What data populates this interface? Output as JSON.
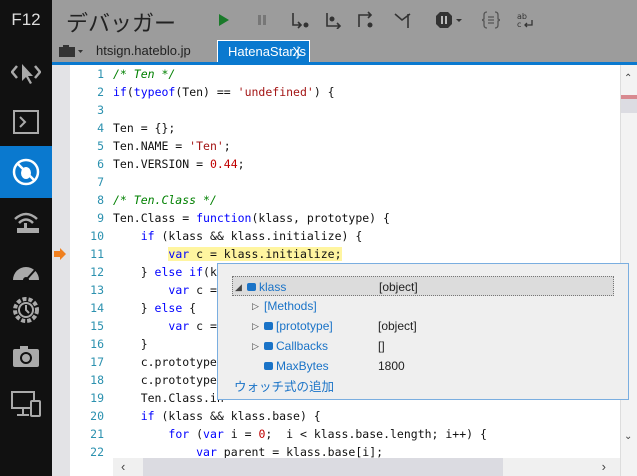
{
  "sidebar": {
    "f12_label": "F12",
    "items": [
      "dom-explorer",
      "console",
      "debugger",
      "network",
      "ui-responsiveness",
      "profiler",
      "memory",
      "emulation"
    ],
    "active": "debugger"
  },
  "toolbar": {
    "title": "デバッガー"
  },
  "tabs": [
    {
      "label": "htsign.hateblo.jp",
      "active": false
    },
    {
      "label": "HatenaStar.js",
      "active": true,
      "close": "X"
    }
  ],
  "code": {
    "current_line": 11,
    "lines": [
      [
        [
          "com",
          "/* Ten */"
        ]
      ],
      [
        [
          "kw",
          "if"
        ],
        [
          "",
          "("
        ],
        [
          "kw",
          "typeof"
        ],
        [
          "",
          "(Ten) == "
        ],
        [
          "str",
          "'undefined'"
        ],
        [
          "",
          ") {"
        ]
      ],
      [],
      [
        [
          "",
          "Ten = {};"
        ]
      ],
      [
        [
          "",
          "Ten.NAME = "
        ],
        [
          "str",
          "'Ten'"
        ],
        [
          "",
          ";"
        ]
      ],
      [
        [
          "",
          "Ten.VERSION = "
        ],
        [
          "num",
          "0.44"
        ],
        [
          "",
          ";"
        ]
      ],
      [],
      [
        [
          "com",
          "/* Ten.Class */"
        ]
      ],
      [
        [
          "",
          "Ten.Class = "
        ],
        [
          "kw",
          "function"
        ],
        [
          "",
          "(klass, prototype) {"
        ]
      ],
      [
        [
          "",
          "    "
        ],
        [
          "kw",
          "if"
        ],
        [
          "",
          " (klass && klass.initialize) {"
        ]
      ],
      [
        [
          "",
          "        "
        ],
        [
          "kw",
          "var"
        ],
        [
          "",
          " c = klass.initialize;"
        ]
      ],
      [
        [
          "",
          "    } "
        ],
        [
          "kw",
          "else if"
        ],
        [
          "",
          "(kl"
        ]
      ],
      [
        [
          "",
          "        "
        ],
        [
          "kw",
          "var"
        ],
        [
          "",
          " c ="
        ]
      ],
      [
        [
          "",
          "    } "
        ],
        [
          "kw",
          "else"
        ],
        [
          "",
          "",
          " {"
        ]
      ],
      [
        [
          "",
          "        "
        ],
        [
          "kw",
          "var"
        ],
        [
          "",
          " c ="
        ]
      ],
      [
        [
          "",
          "    }"
        ]
      ],
      [
        [
          "",
          "    c.prototype"
        ]
      ],
      [
        [
          "",
          "    c.prototype."
        ]
      ],
      [
        [
          "",
          "    Ten.Class.in"
        ]
      ],
      [
        [
          "",
          "    "
        ],
        [
          "kw",
          "if"
        ],
        [
          "",
          "",
          " (klass && klass.base) {"
        ]
      ],
      [
        [
          "",
          "        "
        ],
        [
          "kw",
          "for"
        ],
        [
          "",
          "",
          " ("
        ],
        [
          "kw",
          "var"
        ],
        [
          "",
          "",
          " i = "
        ],
        [
          "num",
          "0"
        ],
        [
          "",
          ";  i < klass.base.length; i++) {"
        ]
      ],
      [
        [
          "",
          "            "
        ],
        [
          "kw",
          "var"
        ],
        [
          "",
          "",
          " parent = klass.base[i];"
        ]
      ],
      [
        [
          "",
          "            "
        ],
        [
          "kw",
          "if"
        ],
        [
          "",
          "",
          " (i == "
        ],
        [
          "num",
          "0"
        ],
        [
          "",
          ") {"
        ]
      ]
    ]
  },
  "watch_popup": {
    "rows": [
      {
        "name": "klass",
        "value": "[object]",
        "expander": "expanded",
        "icon": true
      },
      {
        "name": "[Methods]",
        "value": "",
        "expander": "collapsed",
        "icon": false
      },
      {
        "name": "[prototype]",
        "value": "[object]",
        "expander": "collapsed",
        "icon": true
      },
      {
        "name": "Callbacks",
        "value": "[]",
        "expander": "collapsed",
        "icon": true
      },
      {
        "name": "MaxBytes",
        "value": "1800",
        "expander": "none",
        "icon": true
      }
    ],
    "add_watch": "ウォッチ式の追加"
  }
}
